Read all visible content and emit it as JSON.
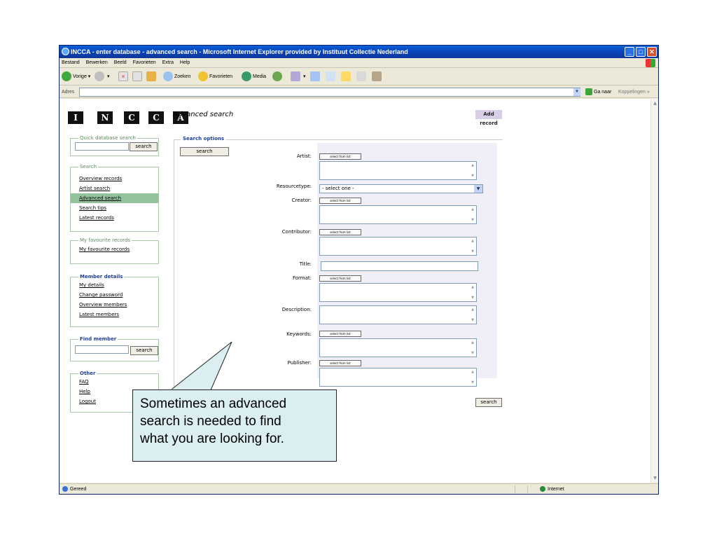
{
  "window": {
    "title": "INCCA - enter database - advanced search - Microsoft Internet Explorer provided by Instituut Collectie Nederland",
    "menu": [
      "Bestand",
      "Bewerken",
      "Beeld",
      "Favorieten",
      "Extra",
      "Help"
    ],
    "toolbar": {
      "back": "Vorige",
      "search": "Zoeken",
      "favorites": "Favorieten",
      "media": "Media"
    },
    "address_label": "Adres",
    "go_label": "Ga naar",
    "links_label": "Koppelingen",
    "status_left": "Gereed",
    "status_zone": "Internet"
  },
  "page": {
    "logo_letters": [
      "I",
      "N",
      "C",
      "C",
      "A"
    ],
    "title": "Advanced search",
    "add_record": "Add record",
    "quick_search": {
      "legend": "Quick database search",
      "button": "search"
    },
    "search_nav": {
      "legend": "Search",
      "items": [
        "Overview records",
        "Artist search",
        "Advanced search",
        "Search tips",
        "Latest records"
      ],
      "active_index": 2
    },
    "favourites": {
      "legend": "My favourite records",
      "items": [
        "My favourite records"
      ]
    },
    "member": {
      "legend": "Member details",
      "items": [
        "My details",
        "Change password",
        "Overview members",
        "Latest members"
      ]
    },
    "find_member": {
      "legend": "Find member",
      "button": "search"
    },
    "other": {
      "legend": "Other",
      "items": [
        "FAQ",
        "Help",
        "Logout"
      ]
    },
    "search_options": {
      "legend": "Search options",
      "top_button": "search",
      "bottom_button": "search",
      "select_from_list": "select from list",
      "fields": {
        "artist": "Artist:",
        "resourcetype": "Resourcetype:",
        "resourcetype_value": "- select one -",
        "creator": "Creator:",
        "contributor": "Contributor:",
        "title": "Title:",
        "format": "Format:",
        "description": "Description:",
        "keywords": "Keywords:",
        "publisher": "Publisher:"
      }
    }
  },
  "callout": {
    "lines": [
      "Sometimes an advanced",
      "search is needed to find",
      "what you are looking for."
    ]
  },
  "colors": {
    "titlebar": "#0a47c4",
    "active_nav": "#93c39c",
    "form_bg": "#f0eef7",
    "callout_bg": "#dbeef2"
  }
}
